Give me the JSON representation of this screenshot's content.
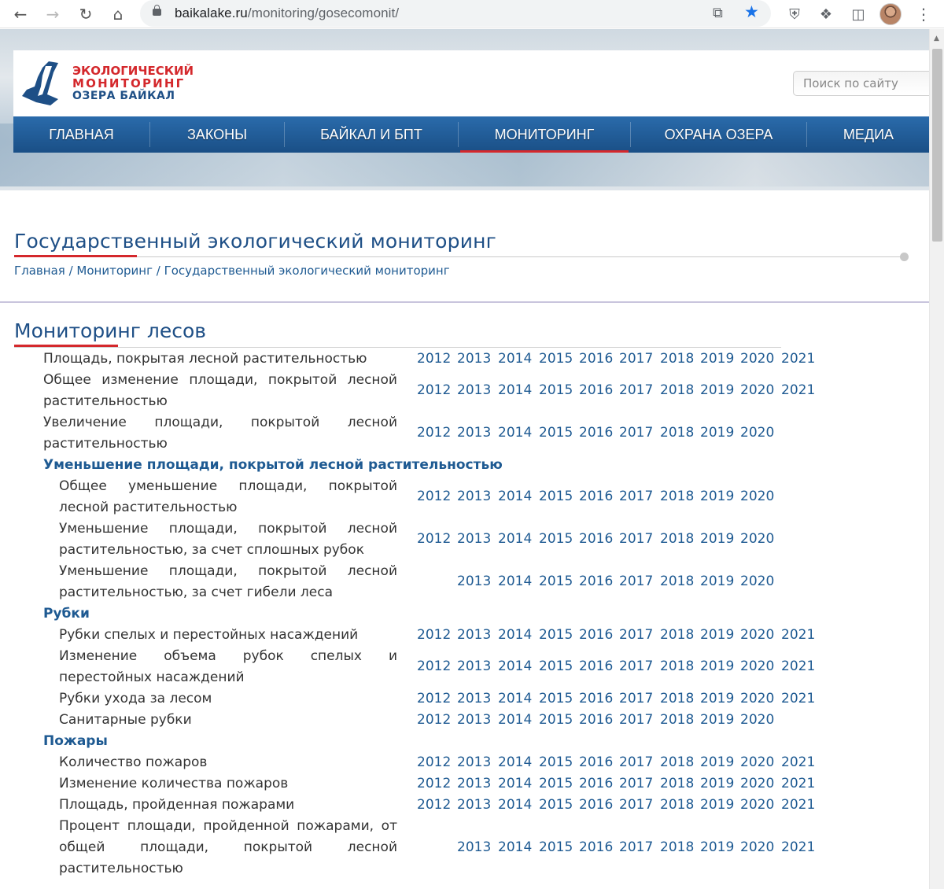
{
  "browser": {
    "url_host": "baikalake.ru",
    "url_path": "/monitoring/gosecomonit/"
  },
  "site": {
    "logo_lines": [
      "ЭКОЛОГИЧЕСКИЙ",
      "МОНИТОРИНГ",
      "ОЗЕРА БАЙКАЛ"
    ],
    "search_placeholder": "Поиск по сайту",
    "nav": [
      "ГЛАВНАЯ",
      "ЗАКОНЫ",
      "БАЙКАЛ И БПТ",
      "МОНИТОРИНГ",
      "ОХРАНА ОЗЕРА",
      "МЕДИА"
    ],
    "nav_active": "МОНИТОРИНГ",
    "colors": {
      "nav_blue": "#1a4f86",
      "accent_red": "#d4282c",
      "link_blue": "#1e5a92"
    }
  },
  "page": {
    "title": "Государственный экологический мониторинг",
    "breadcrumb": [
      "Главная",
      "Мониторинг",
      "Государственный экологический мониторинг"
    ],
    "section_title": "Мониторинг лесов"
  },
  "rows": [
    {
      "label": "Площадь, покрытая лесной растительностью",
      "years": [
        "2012",
        "2013",
        "2014",
        "2015",
        "2016",
        "2017",
        "2018",
        "2019",
        "2020",
        "2021"
      ]
    },
    {
      "label": "Общее изменение площади, покрытой лесной растительностью",
      "years": [
        "2012",
        "2013",
        "2014",
        "2015",
        "2016",
        "2017",
        "2018",
        "2019",
        "2020",
        "2021"
      ]
    },
    {
      "label": "Увеличение площади, покрытой лесной растительностью",
      "years": [
        "2012",
        "2013",
        "2014",
        "2015",
        "2016",
        "2017",
        "2018",
        "2019",
        "2020"
      ]
    },
    {
      "category": "Уменьшение площади, покрытой лесной растительностью"
    },
    {
      "label": "Общее уменьшение площади, покрытой лесной растительностью",
      "years": [
        "2012",
        "2013",
        "2014",
        "2015",
        "2016",
        "2017",
        "2018",
        "2019",
        "2020"
      ]
    },
    {
      "label": "Уменьшение площади, покрытой лесной растительностью, за счет сплошных рубок",
      "years": [
        "2012",
        "2013",
        "2014",
        "2015",
        "2016",
        "2017",
        "2018",
        "2019",
        "2020"
      ]
    },
    {
      "label": "Уменьшение площади, покрытой лесной растительностью, за счет гибели леса",
      "years": [
        "2013",
        "2014",
        "2015",
        "2016",
        "2017",
        "2018",
        "2019",
        "2020"
      ]
    },
    {
      "category": "Рубки"
    },
    {
      "label": "Рубки спелых и перестойных насаждений",
      "years": [
        "2012",
        "2013",
        "2014",
        "2015",
        "2016",
        "2017",
        "2018",
        "2019",
        "2020",
        "2021"
      ]
    },
    {
      "label": "Изменение объема рубок спелых и перестойных насаждений",
      "years": [
        "2012",
        "2013",
        "2014",
        "2015",
        "2016",
        "2017",
        "2018",
        "2019",
        "2020",
        "2021"
      ]
    },
    {
      "label": "Рубки ухода за лесом",
      "years": [
        "2012",
        "2013",
        "2014",
        "2015",
        "2016",
        "2017",
        "2018",
        "2019",
        "2020",
        "2021"
      ]
    },
    {
      "label": "Санитарные рубки",
      "years": [
        "2012",
        "2013",
        "2014",
        "2015",
        "2016",
        "2017",
        "2018",
        "2019",
        "2020"
      ]
    },
    {
      "category": "Пожары"
    },
    {
      "label": "Количество пожаров",
      "years": [
        "2012",
        "2013",
        "2014",
        "2015",
        "2016",
        "2017",
        "2018",
        "2019",
        "2020",
        "2021"
      ]
    },
    {
      "label": "Изменение количества пожаров",
      "years": [
        "2012",
        "2013",
        "2014",
        "2015",
        "2016",
        "2017",
        "2018",
        "2019",
        "2020",
        "2021"
      ]
    },
    {
      "label": "Площадь, пройденная пожарами",
      "years": [
        "2012",
        "2013",
        "2014",
        "2015",
        "2016",
        "2017",
        "2018",
        "2019",
        "2020",
        "2021"
      ]
    },
    {
      "label": "Процент площади, пройденной пожарами, от общей площади, покрытой лесной растительностью",
      "years": [
        "2013",
        "2014",
        "2015",
        "2016",
        "2017",
        "2018",
        "2019",
        "2020",
        "2021"
      ]
    }
  ]
}
